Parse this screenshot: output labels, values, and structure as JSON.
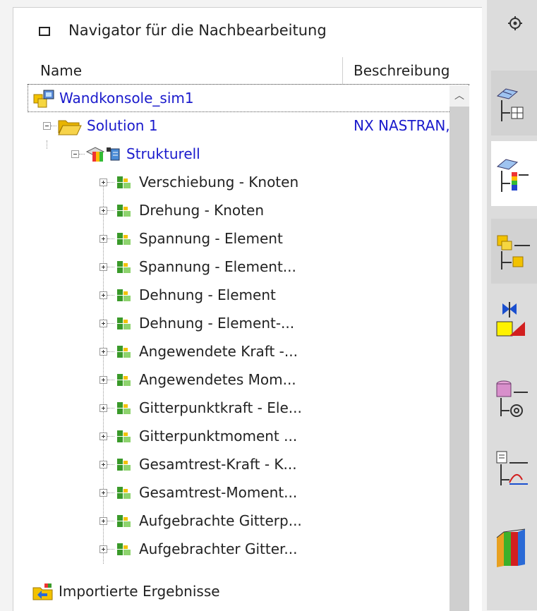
{
  "panel": {
    "title": "Navigator für die Nachbearbeitung",
    "columns": {
      "name": "Name",
      "description": "Beschreibung"
    }
  },
  "tree": {
    "root": {
      "label": "Wandkonsole_sim1",
      "icon": "sim-file-icon"
    },
    "solution": {
      "label": "Solution 1",
      "description": "NX NASTRAN,",
      "icon": "folder-open-icon"
    },
    "structural": {
      "label": "Strukturell",
      "icon": "structural-results-icon"
    },
    "results": [
      "Verschiebung - Knoten",
      "Drehung - Knoten",
      "Spannung - Element",
      "Spannung - Element...",
      "Dehnung - Element",
      "Dehnung - Element-...",
      "Angewendete Kraft -...",
      "Angewendetes Mom...",
      "Gitterpunktkraft - Ele...",
      "Gitterpunktmoment ...",
      "Gesamtrest-Kraft - K...",
      "Gesamtrest-Moment...",
      "Aufgebrachte Gitterp...",
      "Aufgebrachter Gitter..."
    ],
    "imported": {
      "label": "Importierte Ergebnisse",
      "icon": "imported-results-icon"
    }
  },
  "rightbar": {
    "items": [
      "gear-icon",
      "simulation-navigator-icon",
      "post-processing-navigator-icon",
      "assembly-navigator-icon",
      "constraint-navigator-icon",
      "reuse-library-icon",
      "xy-graph-navigator-icon",
      "history-icon"
    ]
  },
  "colors": {
    "link_blue": "#1a1acc",
    "result_green": "#3a9a2a",
    "folder_yellow": "#f2c200"
  }
}
